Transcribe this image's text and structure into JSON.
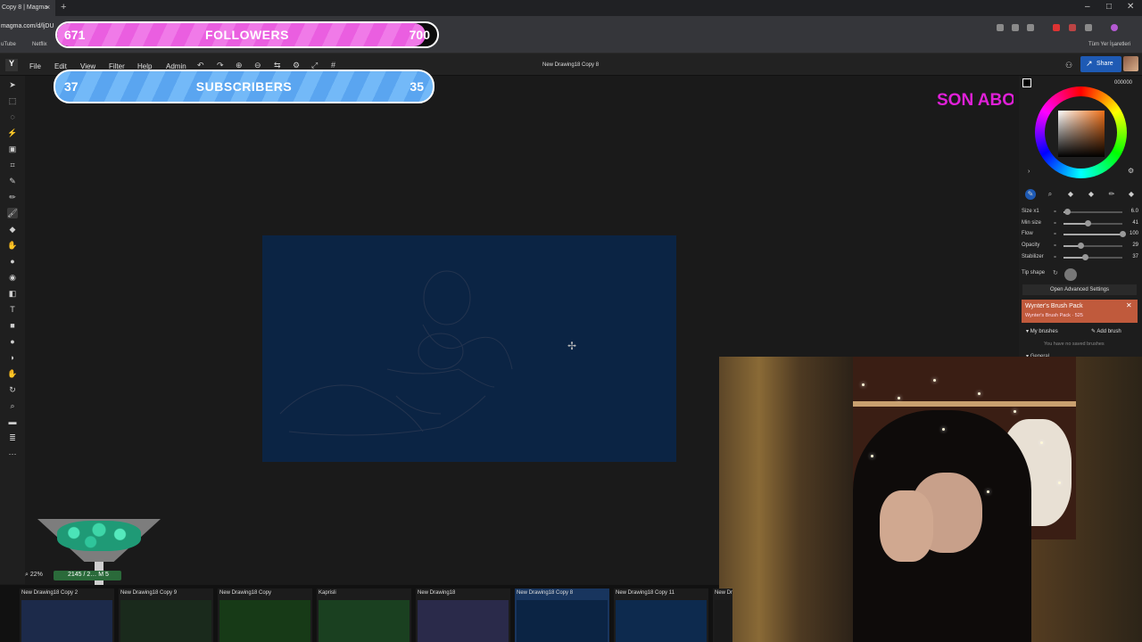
{
  "browser": {
    "tab_title": "Copy 8 | Magma",
    "tab_close": "×",
    "new_tab": "+",
    "url": "magma.com/d/ljDU",
    "window_controls": [
      "–",
      "□",
      "✕"
    ],
    "bookmarks": [
      "uTube",
      "Netflix"
    ],
    "all_bookmarks": "Tüm Yer İşaretleri"
  },
  "app": {
    "menu": [
      "File",
      "Edit",
      "View",
      "Filter",
      "Help",
      "Admin"
    ],
    "doc_title": "New Drawing18 Copy 8",
    "users_count": "1",
    "share_label": "Share"
  },
  "overlays": {
    "followers": {
      "left": "671",
      "label": "FOLLOWERS",
      "right": "700",
      "progress": 0.97
    },
    "subscribers": {
      "left": "37",
      "label": "SUBSCRIBERS",
      "right": "35"
    },
    "son_abo": "SON ABO"
  },
  "color_panel": {
    "hex": "000000",
    "brush_tabs": [
      "1",
      "2",
      "3",
      "4"
    ],
    "sliders": [
      {
        "label": "Size x1",
        "value": "6.0",
        "fraction": 0.06
      },
      {
        "label": "Min size",
        "value": "41",
        "fraction": 0.41
      },
      {
        "label": "Flow",
        "value": "100",
        "fraction": 1.0
      },
      {
        "label": "Opacity",
        "value": "29",
        "fraction": 0.29
      },
      {
        "label": "Stabilizer",
        "value": "37",
        "fraction": 0.37
      }
    ],
    "tip_shape": "Tip shape",
    "advanced": "Open Advanced Settings",
    "promo_title": "Wynter's Brush Pack",
    "promo_sub": "Wynter's Brush Pack · 525",
    "my_brushes": "My brushes",
    "add_brush": "Add brush",
    "no_saved": "You have no saved brushes",
    "general": "General"
  },
  "status": {
    "zoom": "22%",
    "dims": "2145 / 2… M 5"
  },
  "thumbnails": [
    {
      "label": "New Drawing18 Copy 2",
      "color": "#1c2a4a"
    },
    {
      "label": "New Drawing18 Copy 9",
      "color": "#1a2a1c"
    },
    {
      "label": "New Drawing18 Copy",
      "color": "#173a17"
    },
    {
      "label": "Kaprisli",
      "color": "#1a4020"
    },
    {
      "label": "New Drawing18",
      "color": "#2a2a4a"
    },
    {
      "label": "New Drawing18 Copy 8",
      "color": "#0b2444"
    },
    {
      "label": "New Drawing18 Copy 11",
      "color": "#0d2a4e"
    },
    {
      "label": "New Dr",
      "color": "#1a1a1a"
    }
  ]
}
